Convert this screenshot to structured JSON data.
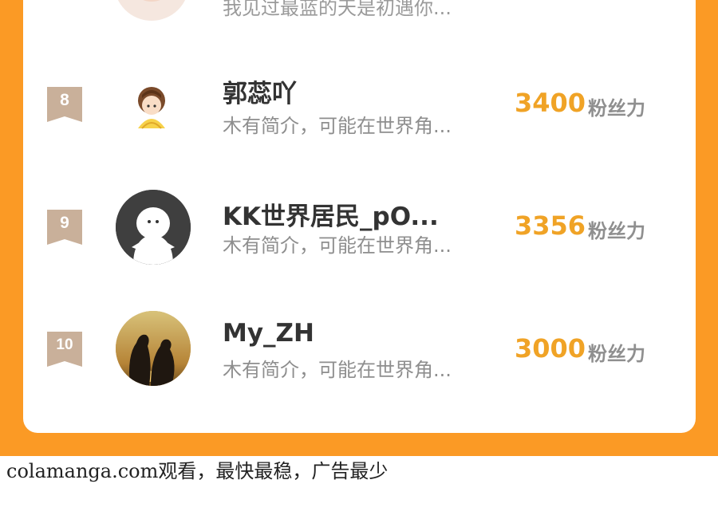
{
  "ranking": {
    "partial_top": {
      "bio": "我见过最蓝的天是初遇你..."
    },
    "rows": [
      {
        "rank": "8",
        "name": "郭蕊吖",
        "bio": "木有简介，可能在世界角...",
        "score": "3400",
        "unit": "粉丝力",
        "avatar": "cartoon-girl-avatar"
      },
      {
        "rank": "9",
        "name": "KK世界居民_pO...",
        "bio": "木有简介，可能在世界角...",
        "score": "3356",
        "unit": "粉丝力",
        "avatar": "default-ghost-avatar"
      },
      {
        "rank": "10",
        "name": "My_ZH",
        "bio": "木有简介，可能在世界角...",
        "score": "3000",
        "unit": "粉丝力",
        "avatar": "penguins-sunset-avatar"
      }
    ]
  },
  "footer": {
    "text": "colamanga.com观看，最快最稳，广告最少"
  },
  "colors": {
    "frame": "#fb9a25",
    "score": "#f0a326",
    "badge": "#c9b09a"
  }
}
